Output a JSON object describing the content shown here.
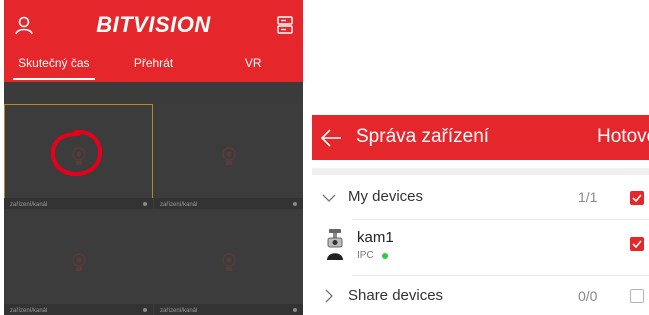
{
  "left_app": {
    "logo": "BITVISION",
    "tabs": [
      {
        "label": "Skutečný čas",
        "active": true
      },
      {
        "label": "Přehrát",
        "active": false
      },
      {
        "label": "VR",
        "active": false
      }
    ],
    "cells": [
      {
        "label": "zařízení/kanál",
        "selected": true,
        "annotated": true
      },
      {
        "label": "zařízení/kanál",
        "selected": false,
        "annotated": false
      },
      {
        "label": "zařízení/kanál",
        "selected": false,
        "annotated": false
      },
      {
        "label": "zařízení/kanál",
        "selected": false,
        "annotated": false
      }
    ],
    "icons": {
      "user": "user-icon",
      "list": "device-list-icon",
      "camera": "camera-placeholder-icon"
    }
  },
  "right_app": {
    "title": "Správa zařízení",
    "done_label": "Hotovo",
    "groups": [
      {
        "name": "My devices",
        "count": "1/1",
        "checked": true,
        "expanded": true
      },
      {
        "name": "Share devices",
        "count": "0/0",
        "checked": false,
        "expanded": false
      }
    ],
    "device": {
      "name": "kam1",
      "type": "IPC",
      "online": true,
      "checked": true
    }
  },
  "colors": {
    "brand_red": "#e5262b",
    "status_online": "#2ecc40",
    "selected_border": "#b08a2a"
  }
}
